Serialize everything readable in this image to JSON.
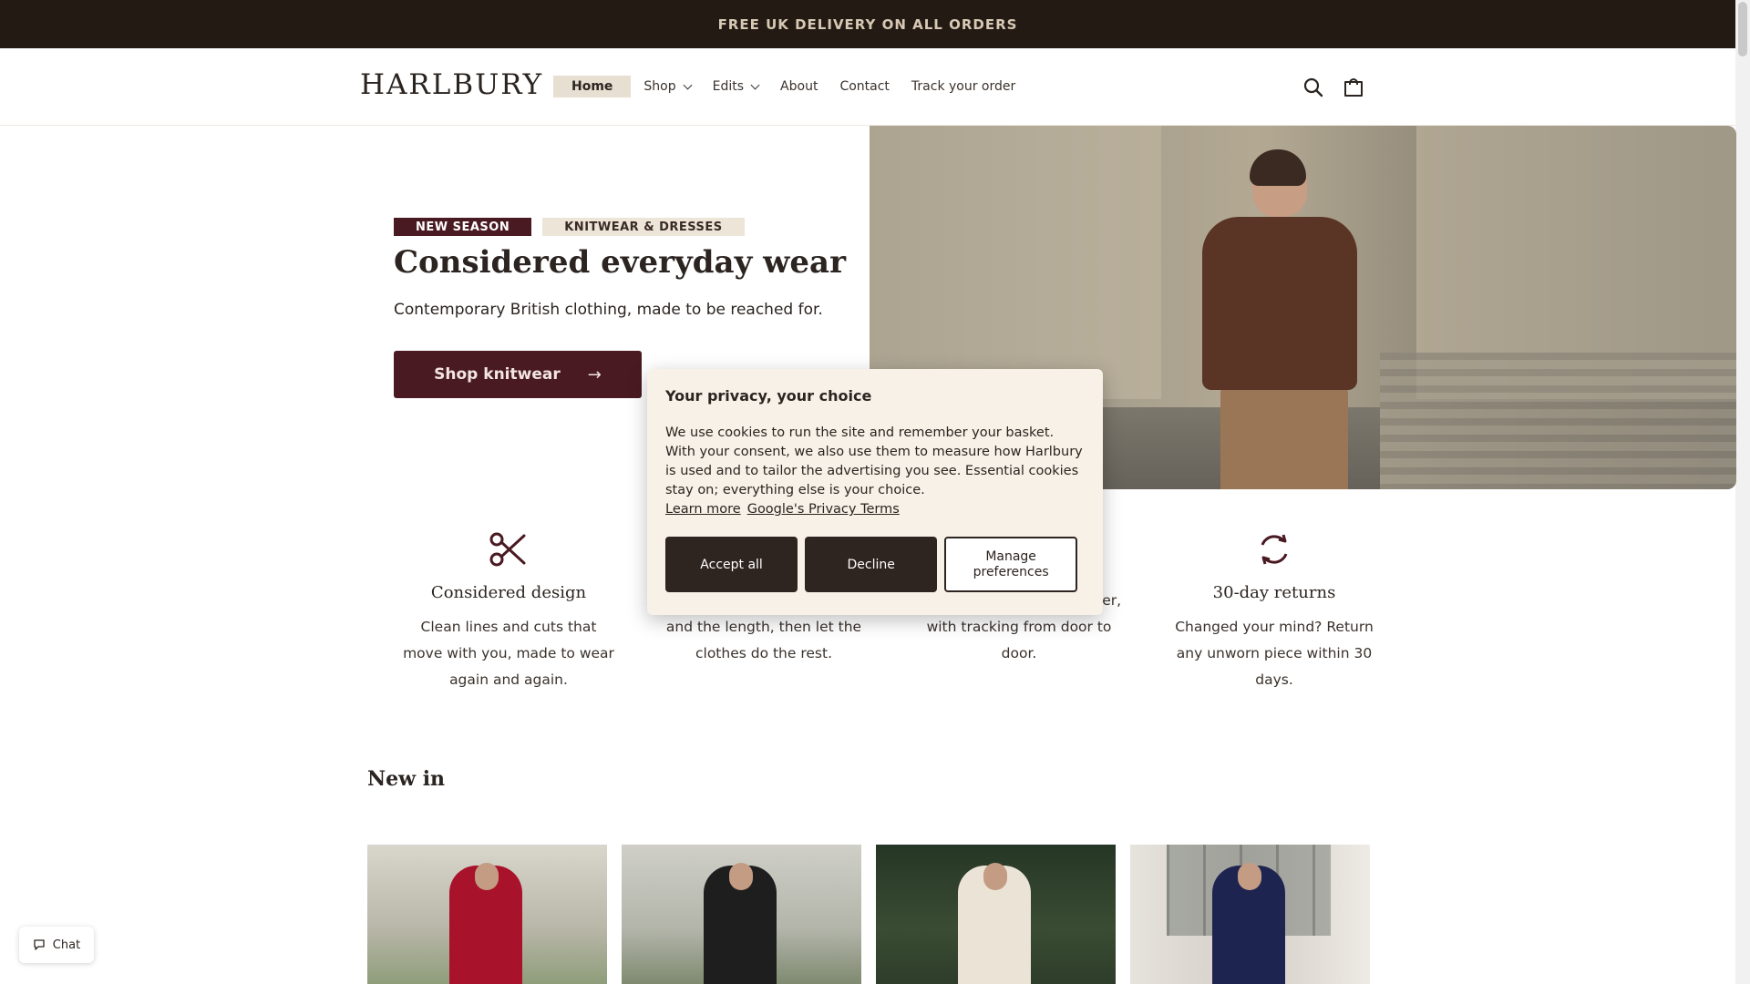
{
  "announcement": {
    "text": "FREE UK DELIVERY ON ALL ORDERS"
  },
  "header": {
    "logo": "HARLBURY",
    "nav": [
      {
        "label": "Home",
        "active": true
      },
      {
        "label": "Shop",
        "dropdown": true
      },
      {
        "label": "Edits",
        "dropdown": true
      },
      {
        "label": "About"
      },
      {
        "label": "Contact"
      },
      {
        "label": "Track your order"
      }
    ],
    "icons": [
      "search-icon",
      "cart-icon"
    ]
  },
  "hero": {
    "badges": [
      "NEW SEASON",
      "KNITWEAR & DRESSES"
    ],
    "title": "Considered everyday wear",
    "subtitle": "Contemporary British clothing, made to be reached for.",
    "cta_label": "Shop knitwear",
    "cta_arrow": "→"
  },
  "features": [
    {
      "icon": "scissors-icon",
      "title": "Considered design",
      "text": "Clean lines and cuts that move with you, made to wear again and again."
    },
    {
      "icon": "fabric-icon",
      "title": "",
      "text": "We name the fabric, the cut and the length, then let the clothes do the rest."
    },
    {
      "icon": "delivery-icon",
      "title": "",
      "text": "Free delivery on every order, with tracking from door to door."
    },
    {
      "icon": "refresh-icon",
      "title": "30-day returns",
      "text": "Changed your mind? Return any unworn piece within 30 days."
    }
  ],
  "new_in": {
    "title": "New in"
  },
  "chat": {
    "label": "Chat"
  },
  "cookie": {
    "title": "Your privacy, your choice",
    "body": "We use cookies to run the site and remember your basket. With your consent, we also use them to measure how Harlbury is used and to tailor the advertising you see. Essential cookies stay on; everything else is your choice.",
    "links": [
      "Learn more",
      "Google's Privacy Terms"
    ],
    "accept": "Accept all",
    "decline": "Decline",
    "manage": "Manage preferences"
  },
  "colors": {
    "brand": "#4a1a22",
    "dark": "#231a14",
    "cream": "#f7f1e7"
  }
}
